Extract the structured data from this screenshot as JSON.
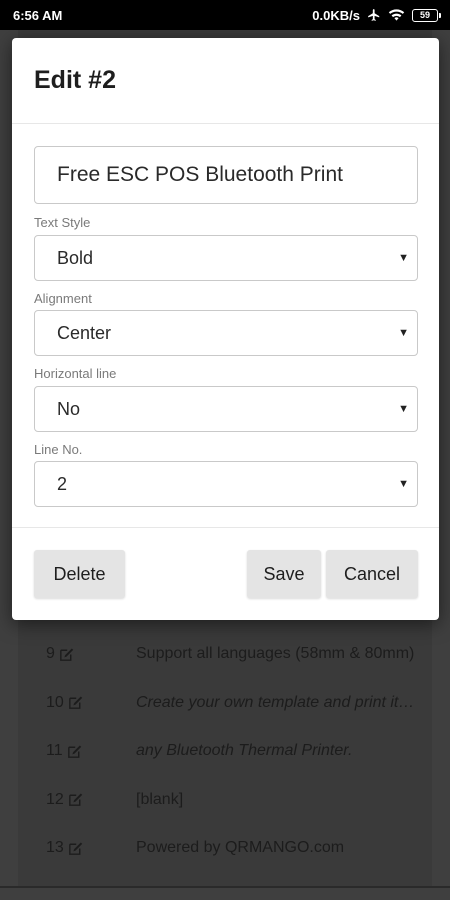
{
  "status_bar": {
    "time": "6:56 AM",
    "network_speed": "0.0KB/s",
    "battery_level": "59",
    "icons": [
      "airplane-icon",
      "wifi-icon",
      "battery-icon"
    ]
  },
  "dialog": {
    "title": "Edit #2",
    "text_value": "Free ESC POS Bluetooth Print",
    "fields": {
      "text_style": {
        "label": "Text Style",
        "value": "Bold"
      },
      "alignment": {
        "label": "Alignment",
        "value": "Center"
      },
      "horizontal_line": {
        "label": "Horizontal line",
        "value": "No"
      },
      "line_no": {
        "label": "Line No.",
        "value": "2"
      }
    },
    "buttons": {
      "delete": "Delete",
      "save": "Save",
      "cancel": "Cancel"
    }
  },
  "background_list": [
    {
      "num": "9",
      "text": "Support all languages (58mm & 80mm)",
      "italic": false
    },
    {
      "num": "10",
      "text": "Create your own template and print it on",
      "italic": true
    },
    {
      "num": "11",
      "text": "any Bluetooth Thermal Printer.",
      "italic": true
    },
    {
      "num": "12",
      "text": "[blank]",
      "italic": false
    },
    {
      "num": "13",
      "text": "Powered by QRMANGO.com",
      "italic": false
    }
  ]
}
